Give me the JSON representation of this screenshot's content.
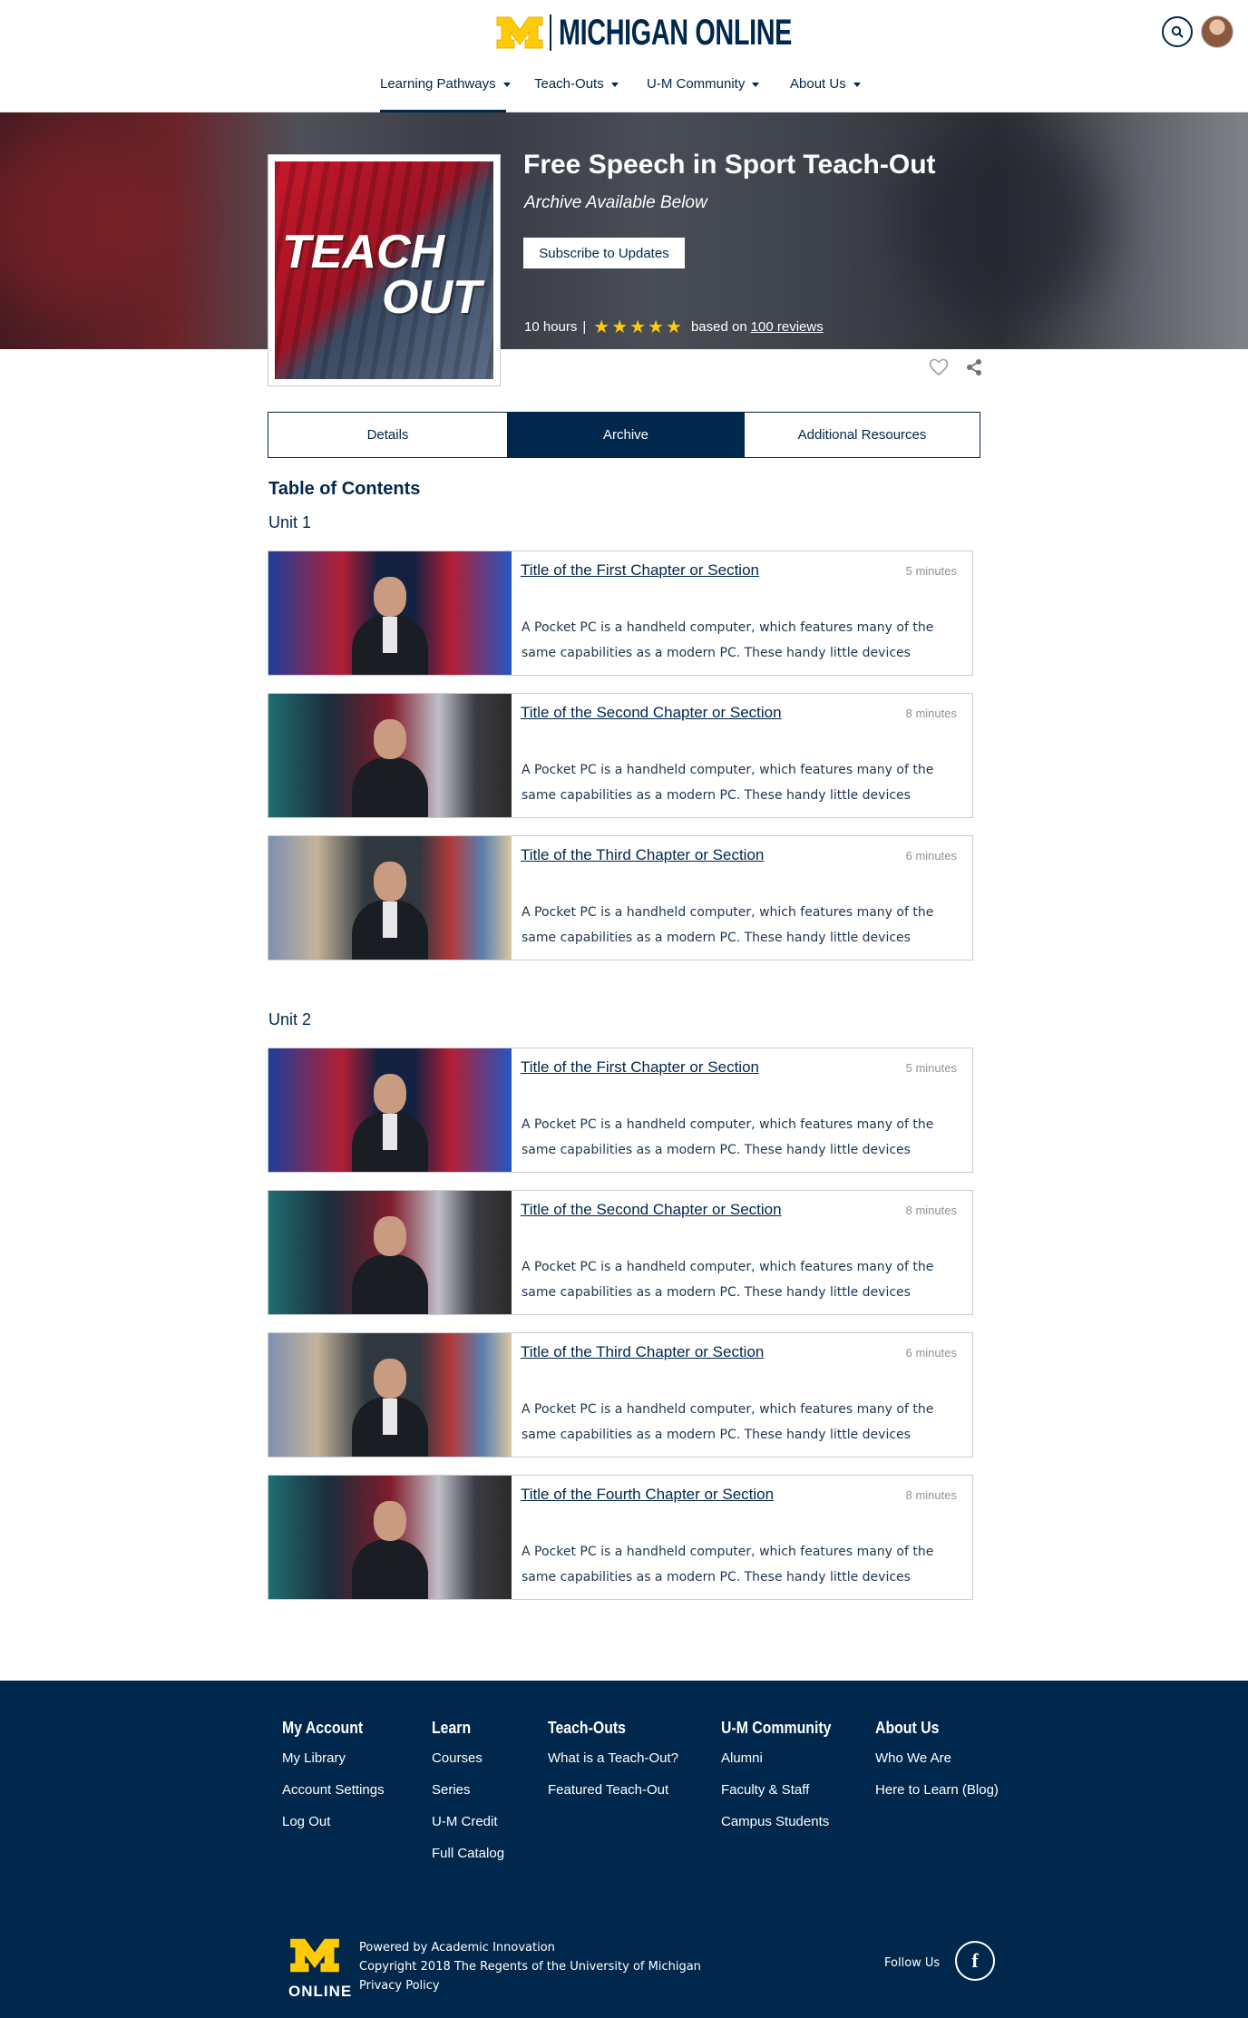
{
  "brand": {
    "name": "MICHIGAN ONLINE"
  },
  "colors": {
    "maize": "#ffcb05",
    "blue": "#00274c"
  },
  "nav": [
    {
      "label": "Learning Pathways"
    },
    {
      "label": "Teach-Outs"
    },
    {
      "label": "U-M Community"
    },
    {
      "label": "About Us"
    }
  ],
  "hero": {
    "title": "Free Speech in Sport Teach-Out",
    "subtitle": "Archive Available Below",
    "subscribe_label": "Subscribe to Updates",
    "duration": "10 hours",
    "separator": "|",
    "stars": "★★★★★",
    "based_on": "based on",
    "reviews": "100 reviews",
    "thumb_line1": "TEACH",
    "thumb_line2": "OUT"
  },
  "tabs": [
    {
      "label": "Details"
    },
    {
      "label": "Archive"
    },
    {
      "label": "Additional Resources"
    }
  ],
  "toc_title": "Table of Contents",
  "units": [
    {
      "label": "Unit 1",
      "items": [
        {
          "title": "Title of the First Chapter or Section",
          "minutes": "5 minutes",
          "desc": "A Pocket PC is a handheld computer, which features many of the same capabilities as a modern PC. These handy little devices allow..."
        },
        {
          "title": "Title of the Second Chapter or Section",
          "minutes": "8 minutes",
          "desc": "A Pocket PC is a handheld computer, which features many of the same capabilities as a modern PC. These handy little devices allow..."
        },
        {
          "title": "Title of the Third Chapter or Section",
          "minutes": "6 minutes",
          "desc": "A Pocket PC is a handheld computer, which features many of the same capabilities as a modern PC. These handy little devices allow..."
        }
      ]
    },
    {
      "label": "Unit 2",
      "items": [
        {
          "title": "Title of the First Chapter or Section",
          "minutes": "5 minutes",
          "desc": "A Pocket PC is a handheld computer, which features many of the same capabilities as a modern PC. These handy little devices allow..."
        },
        {
          "title": "Title of the Second Chapter or Section",
          "minutes": "8 minutes",
          "desc": "A Pocket PC is a handheld computer, which features many of the same capabilities as a modern PC. These handy little devices allow..."
        },
        {
          "title": "Title of the Third Chapter or Section",
          "minutes": "6 minutes",
          "desc": "A Pocket PC is a handheld computer, which features many of the same capabilities as a modern PC. These handy little devices allow..."
        },
        {
          "title": "Title of the Fourth Chapter or Section",
          "minutes": "8 minutes",
          "desc": "A Pocket PC is a handheld computer, which features many of the same capabilities as a modern PC. These handy little devices allow..."
        }
      ]
    }
  ],
  "footer": {
    "columns": [
      {
        "heading": "My Account",
        "links": [
          "My Library",
          "Account Settings",
          "Log Out"
        ]
      },
      {
        "heading": "Learn",
        "links": [
          "Courses",
          "Series",
          "U-M Credit",
          "Full Catalog"
        ]
      },
      {
        "heading": "Teach-Outs",
        "links": [
          "What is a Teach-Out?",
          "Featured Teach-Out"
        ]
      },
      {
        "heading": "U-M Community",
        "links": [
          "Alumni",
          "Faculty & Staff",
          "Campus Students"
        ]
      },
      {
        "heading": "About Us",
        "links": [
          "Who We Are",
          "Here to Learn (Blog)"
        ]
      }
    ],
    "logo_text": "ONLINE",
    "powered": "Powered by Academic Innovation",
    "copyright": "Copyright 2018 The Regents of the University of Michigan",
    "privacy": "Privacy Policy",
    "follow": "Follow Us",
    "facebook_glyph": "f"
  }
}
